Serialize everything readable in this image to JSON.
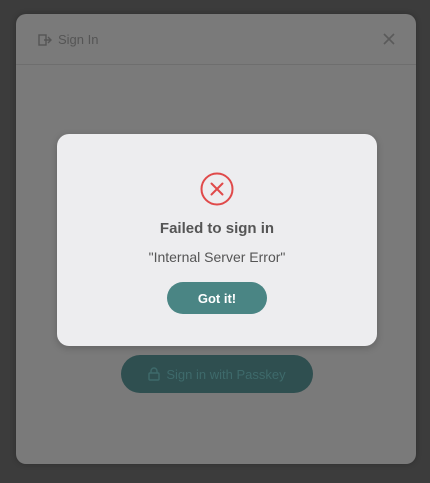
{
  "signin": {
    "title": "Sign In",
    "passkey_label": "Sign in with Passkey"
  },
  "dialog": {
    "title": "Failed to sign in",
    "message": "\"Internal Server Error\"",
    "button_label": "Got it!"
  },
  "colors": {
    "accent": "#4a8584",
    "error": "#e04a4a"
  },
  "icons": {
    "header": "login-icon",
    "close": "close-icon",
    "passkey": "lock-icon",
    "error": "error-circle-x-icon"
  }
}
